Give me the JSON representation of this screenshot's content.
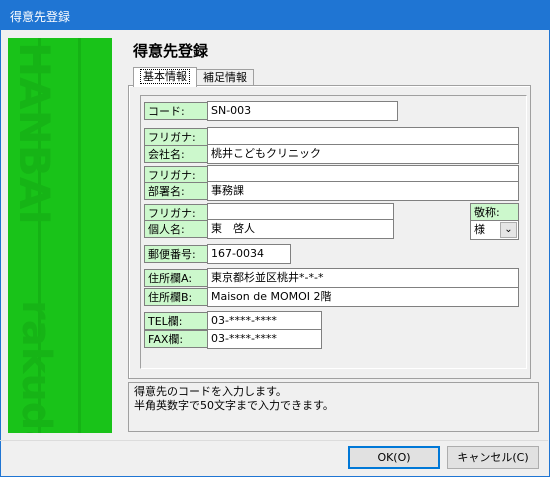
{
  "window": {
    "title": "得意先登録"
  },
  "banner": {
    "word_top": "HANBAI",
    "word_bottom": "rakuda"
  },
  "heading": "得意先登録",
  "tabs": [
    {
      "label": "基本情報",
      "active": true
    },
    {
      "label": "補足情報",
      "active": false
    }
  ],
  "fields": {
    "code": {
      "label": "コード:",
      "value": "SN-003"
    },
    "company_kana": {
      "label": "フリガナ:",
      "value": ""
    },
    "company_name": {
      "label": "会社名:",
      "value": "桃井こどもクリニック"
    },
    "dept_kana": {
      "label": "フリガナ:",
      "value": ""
    },
    "dept_name": {
      "label": "部署名:",
      "value": "事務課"
    },
    "person_kana": {
      "label": "フリガナ:",
      "value": ""
    },
    "person_name": {
      "label": "個人名:",
      "value": "東　啓人"
    },
    "honorific": {
      "label": "敬称:",
      "value": "様"
    },
    "postal": {
      "label": "郵便番号:",
      "value": "167-0034"
    },
    "address_a": {
      "label": "住所欄A:",
      "value": "東京都杉並区桃井*-*-*"
    },
    "address_b": {
      "label": "住所欄B:",
      "value": "Maison de MOMOI 2階"
    },
    "tel": {
      "label": "TEL欄:",
      "value": "03-****-****"
    },
    "fax": {
      "label": "FAX欄:",
      "value": "03-****-****"
    }
  },
  "help": {
    "line1": "得意先のコードを入力します。",
    "line2": "半角英数字で50文字まで入力できます。"
  },
  "buttons": {
    "ok": "OK(O)",
    "cancel": "キャンセル(C)"
  },
  "colors": {
    "titlebar": "#1f75d3",
    "banner": "#19c319",
    "label_bg": "#ccf8cc"
  }
}
